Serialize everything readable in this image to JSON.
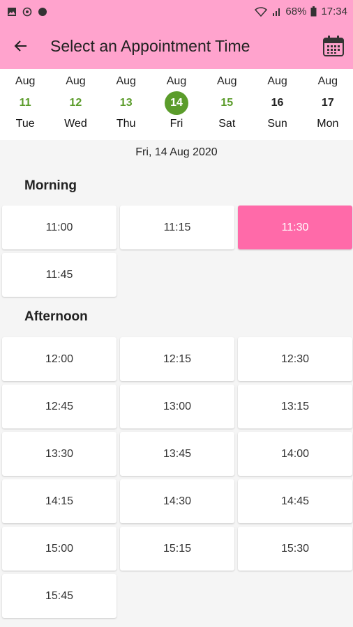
{
  "status_bar": {
    "battery": "68%",
    "time": "17:34"
  },
  "app_bar": {
    "title": "Select an Appointment Time"
  },
  "week": [
    {
      "month": "Aug",
      "day": "11",
      "weekday": "Tue",
      "state": "available"
    },
    {
      "month": "Aug",
      "day": "12",
      "weekday": "Wed",
      "state": "available"
    },
    {
      "month": "Aug",
      "day": "13",
      "weekday": "Thu",
      "state": "available"
    },
    {
      "month": "Aug",
      "day": "14",
      "weekday": "Fri",
      "state": "selected"
    },
    {
      "month": "Aug",
      "day": "15",
      "weekday": "Sat",
      "state": "available"
    },
    {
      "month": "Aug",
      "day": "16",
      "weekday": "Sun",
      "state": "unavailable"
    },
    {
      "month": "Aug",
      "day": "17",
      "weekday": "Mon",
      "state": "unavailable"
    }
  ],
  "selected_date": "Fri, 14 Aug 2020",
  "morning": {
    "title": "Morning",
    "slots": [
      "11:00",
      "11:15",
      "11:30",
      "11:45"
    ]
  },
  "afternoon": {
    "title": "Afternoon",
    "slots": [
      "12:00",
      "12:15",
      "12:30",
      "12:45",
      "13:00",
      "13:15",
      "13:30",
      "13:45",
      "14:00",
      "14:15",
      "14:30",
      "14:45",
      "15:00",
      "15:15",
      "15:30",
      "15:45"
    ]
  },
  "selected_slot": "11:30",
  "colors": {
    "header": "#ffa3cd",
    "accent_green": "#5b9c2b",
    "selected_slot": "#ff6aa9"
  }
}
